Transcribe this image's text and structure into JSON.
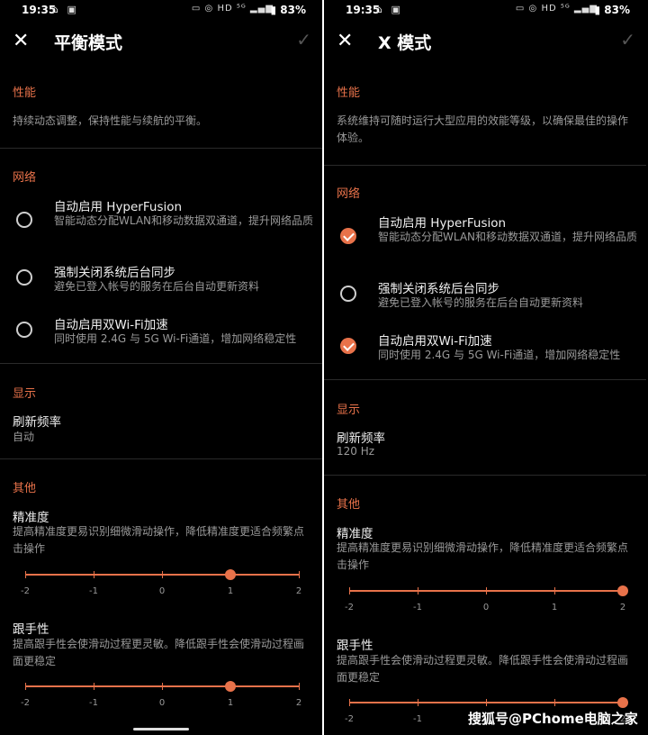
{
  "status_bar": {
    "time": "19:35",
    "network": "HD",
    "battery": "83%"
  },
  "left": {
    "title": "平衡模式",
    "perf": {
      "heading": "性能",
      "desc": "持续动态调整，保持性能与续航的平衡。"
    },
    "network": {
      "heading": "网络",
      "items": [
        {
          "title": "自动启用 HyperFusion",
          "sub": "智能动态分配WLAN和移动数据双通道，提升网络品质",
          "checked": false
        },
        {
          "title": "强制关闭系统后台同步",
          "sub": "避免已登入帐号的服务在后台自动更新资料",
          "checked": false
        },
        {
          "title": "自动启用双Wi-Fi加速",
          "sub": "同时使用 2.4G 与 5G Wi-Fi通道，增加网络稳定性",
          "checked": false
        }
      ]
    },
    "display": {
      "heading": "显示",
      "refresh_title": "刷新频率",
      "refresh_value": "自动"
    },
    "other": {
      "heading": "其他",
      "accuracy": {
        "title": "精准度",
        "desc": "提高精准度更易识别细微滑动操作，降低精准度更适合频繁点击操作",
        "value": 1
      },
      "follow": {
        "title": "跟手性",
        "desc": "提高跟手性会使滑动过程更灵敏。降低跟手性会使滑动过程画面更稳定",
        "value": 1
      }
    }
  },
  "right": {
    "title": "X 模式",
    "perf": {
      "heading": "性能",
      "desc": "系统维持可随时运行大型应用的效能等级，以确保最佳的操作体验。"
    },
    "network": {
      "heading": "网络",
      "items": [
        {
          "title": "自动启用 HyperFusion",
          "sub": "智能动态分配WLAN和移动数据双通道，提升网络品质",
          "checked": true
        },
        {
          "title": "强制关闭系统后台同步",
          "sub": "避免已登入帐号的服务在后台自动更新资料",
          "checked": false
        },
        {
          "title": "自动启用双Wi-Fi加速",
          "sub": "同时使用 2.4G 与 5G Wi-Fi通道，增加网络稳定性",
          "checked": true
        }
      ]
    },
    "display": {
      "heading": "显示",
      "refresh_title": "刷新频率",
      "refresh_value": "120 Hz"
    },
    "other": {
      "heading": "其他",
      "accuracy": {
        "title": "精准度",
        "desc": "提高精准度更易识别细微滑动操作，降低精准度更适合频繁点击操作",
        "value": 2
      },
      "follow": {
        "title": "跟手性",
        "desc": "提高跟手性会使滑动过程更灵敏。降低跟手性会使滑动过程画面更稳定",
        "value": 2
      }
    }
  },
  "slider_ticks": [
    "-2",
    "-1",
    "0",
    "1",
    "2"
  ],
  "watermark": "搜狐号@PChome电脑之家",
  "colors": {
    "accent": "#e8724a",
    "background": "#000000"
  }
}
